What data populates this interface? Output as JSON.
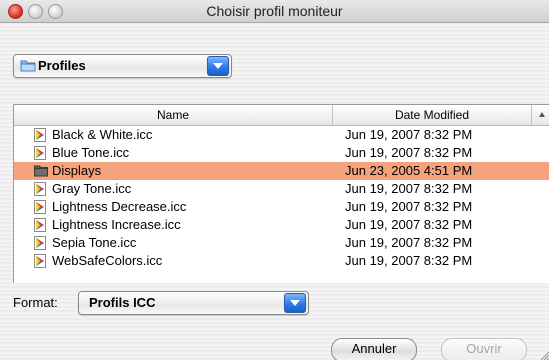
{
  "window": {
    "title": "Choisir profil moniteur"
  },
  "location_popup": {
    "label": "Profiles",
    "icon": "folder-icon"
  },
  "file_list": {
    "columns": {
      "name": "Name",
      "date": "Date Modified"
    },
    "sort_indicator": "sort-ascending-icon",
    "rows": [
      {
        "name": "Black & White.icc",
        "date": "Jun 19, 2007 8:32 PM",
        "icon": "icc-profile-icon",
        "selected": false
      },
      {
        "name": "Blue Tone.icc",
        "date": "Jun 19, 2007 8:32 PM",
        "icon": "icc-profile-icon",
        "selected": false
      },
      {
        "name": "Displays",
        "date": "Jun 23, 2005 4:51 PM",
        "icon": "folder-icon",
        "selected": true
      },
      {
        "name": "Gray Tone.icc",
        "date": "Jun 19, 2007 8:32 PM",
        "icon": "icc-profile-icon",
        "selected": false
      },
      {
        "name": "Lightness Decrease.icc",
        "date": "Jun 19, 2007 8:32 PM",
        "icon": "icc-profile-icon",
        "selected": false
      },
      {
        "name": "Lightness Increase.icc",
        "date": "Jun 19, 2007 8:32 PM",
        "icon": "icc-profile-icon",
        "selected": false
      },
      {
        "name": "Sepia Tone.icc",
        "date": "Jun 19, 2007 8:32 PM",
        "icon": "icc-profile-icon",
        "selected": false
      },
      {
        "name": "WebSafeColors.icc",
        "date": "Jun 19, 2007 8:32 PM",
        "icon": "icc-profile-icon",
        "selected": false
      }
    ]
  },
  "format": {
    "label": "Format:",
    "value": "Profils ICC"
  },
  "buttons": {
    "cancel": "Annuler",
    "open": "Ouvrir"
  },
  "colors": {
    "selection": "#f5a37c",
    "accent": "#2e7ae6"
  }
}
